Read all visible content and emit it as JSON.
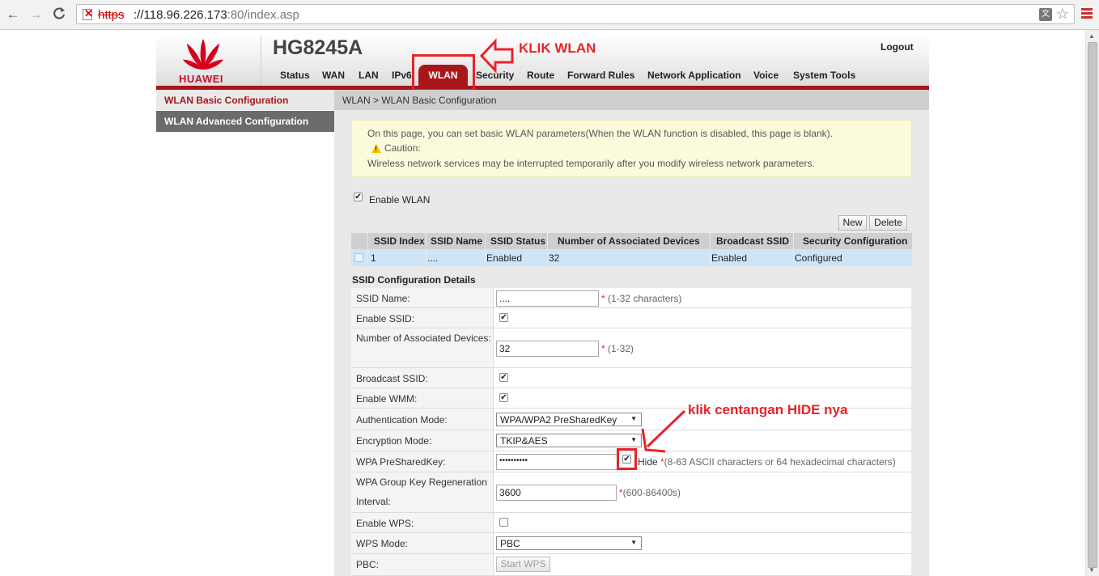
{
  "browser": {
    "back": "←",
    "forward": "→",
    "reload": "C",
    "url_scheme": "https",
    "url_host": "://118.96.226.173",
    "url_port_path": ":80/index.asp"
  },
  "header": {
    "logo_text": "HUAWEI",
    "model": "HG8245A",
    "logout": "Logout",
    "tabs": [
      "Status",
      "WAN",
      "LAN",
      "IPv6",
      "WLAN",
      "Security",
      "Route",
      "Forward Rules",
      "Network Application",
      "Voice",
      "System Tools"
    ],
    "active_tab": "WLAN"
  },
  "annotations": {
    "klik_wlan": "KLIK WLAN",
    "klik_hide": "klik centangan HIDE nya"
  },
  "leftnav": {
    "items": [
      "WLAN Basic Configuration",
      "WLAN Advanced Configuration"
    ]
  },
  "breadcrumb": "WLAN > WLAN Basic Configuration",
  "info": {
    "line1": "On this page, you can set basic WLAN parameters(When the WLAN function is disabled, this page is blank).",
    "caution": "Caution:",
    "line3": "Wireless network services may be interrupted temporarily after you modify wireless network parameters."
  },
  "enable_wlan": {
    "label": "Enable WLAN",
    "checked": true
  },
  "buttons": {
    "new": "New",
    "delete": "Delete"
  },
  "ssid_table": {
    "headers": [
      "SSID Index",
      "SSID Name",
      "SSID Status",
      "Number of Associated Devices",
      "Broadcast SSID",
      "Security Configuration"
    ],
    "rows": [
      [
        "1",
        "....",
        "Enabled",
        "32",
        "Enabled",
        "Configured"
      ]
    ]
  },
  "details": {
    "title": "SSID Configuration Details",
    "ssid_name_label": "SSID Name:",
    "ssid_name_value": "....",
    "ssid_name_hint": "(1-32 characters)",
    "enable_ssid_label": "Enable SSID:",
    "assoc_label": "Number of Associated Devices:",
    "assoc_value": "32",
    "assoc_hint": "(1-32)",
    "broadcast_label": "Broadcast SSID:",
    "wmm_label": "Enable WMM:",
    "auth_label": "Authentication Mode:",
    "auth_value": "WPA/WPA2 PreSharedKey",
    "enc_label": "Encryption Mode:",
    "enc_value": "TKIP&AES",
    "psk_label": "WPA PreSharedKey:",
    "psk_value": "••••••••••",
    "hide_label": "Hide",
    "psk_hint": "(8-63 ASCII characters or 64 hexadecimal characters)",
    "group_label": "WPA Group Key Regeneration Interval:",
    "group_value": "3600",
    "group_hint": "(600-86400s)",
    "wps_label": "Enable WPS:",
    "wps_mode_label": "WPS Mode:",
    "wps_mode_value": "PBC",
    "pbc_label": "PBC:",
    "start_wps": "Start WPS",
    "required_mark": "*"
  },
  "colors": {
    "brand_red": "#a9161a",
    "annotation_red": "#e8232a",
    "row_highlight": "#cde5f7"
  }
}
